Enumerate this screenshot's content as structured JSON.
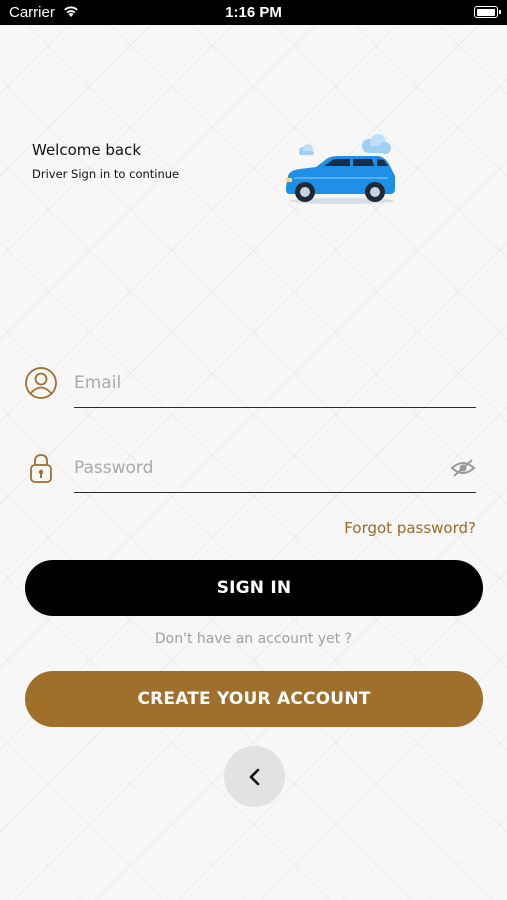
{
  "status_bar": {
    "carrier": "Carrier",
    "time": "1:16 PM",
    "battery_level": 1.0
  },
  "header": {
    "title": "Welcome back",
    "subtitle": "Driver Sign in to continue"
  },
  "form": {
    "email": {
      "placeholder": "Email",
      "value": ""
    },
    "password": {
      "placeholder": "Password",
      "value": ""
    },
    "forgot_label": "Forgot password?"
  },
  "actions": {
    "signin_label": "SIGN IN",
    "no_account_text": "Don't have an account yet ?",
    "create_label": "CREATE YOUR ACCOUNT"
  },
  "icons": {
    "user": "user-circle-icon",
    "lock": "lock-icon",
    "eye": "eye-off-icon",
    "back": "chevron-left-icon",
    "car": "car-illustration"
  },
  "colors": {
    "accent": "#a06f2b",
    "primary": "#000000",
    "car": "#1e8fe6"
  }
}
